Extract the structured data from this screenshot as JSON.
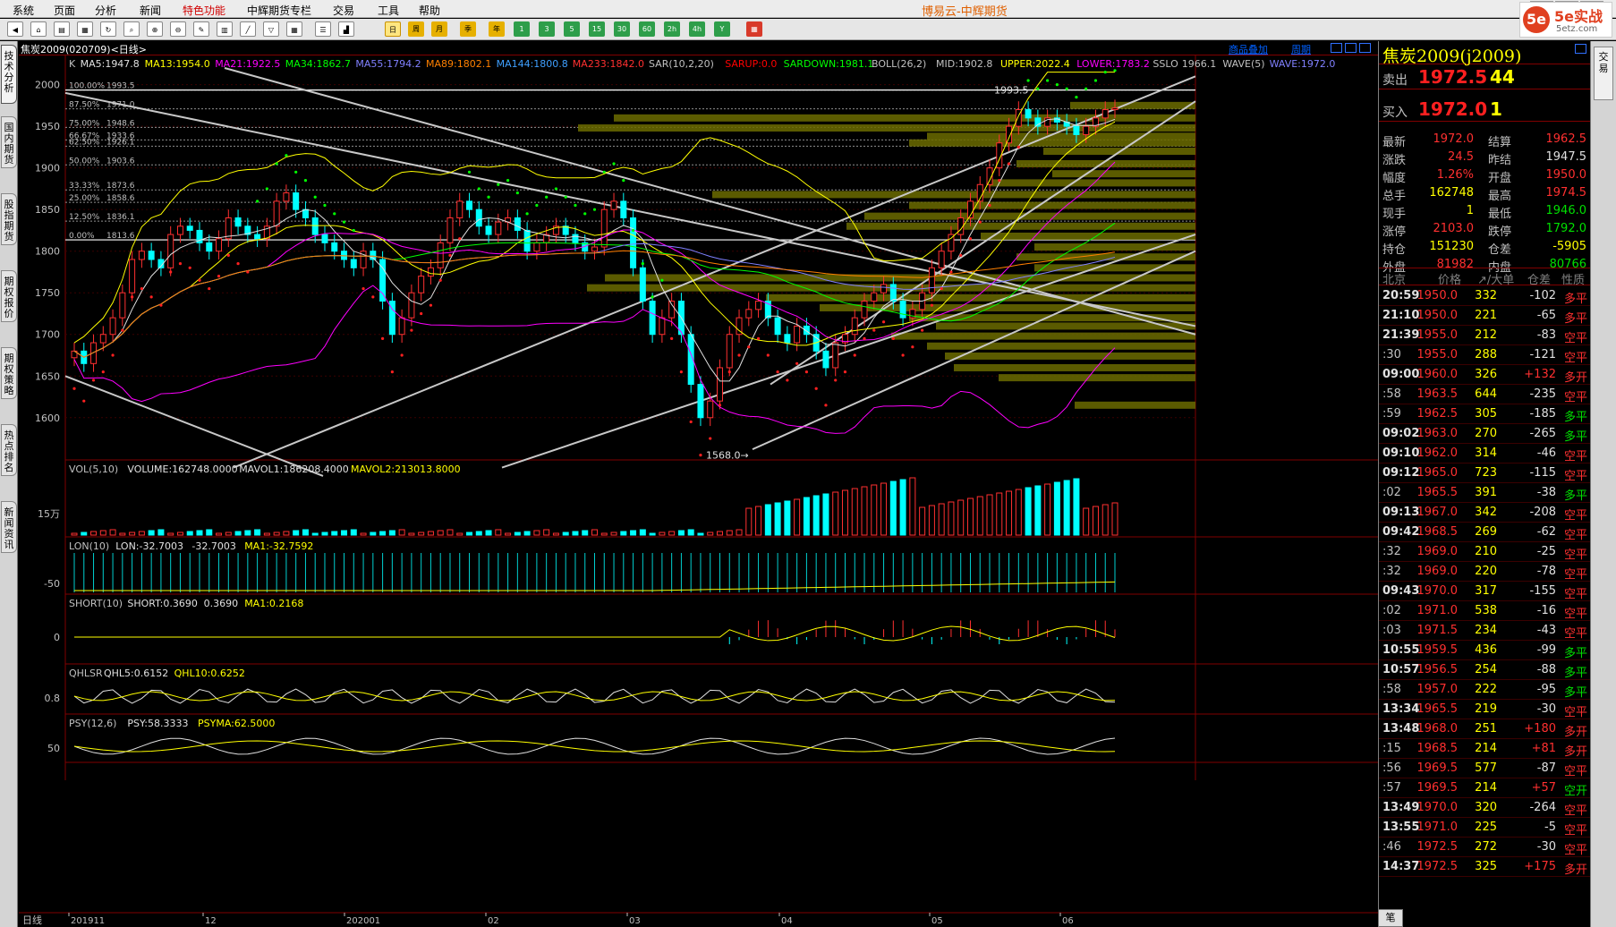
{
  "app_title": "博易云-中辉期货",
  "menu": [
    "系统",
    "页面",
    "分析",
    "新闻",
    "特色功能",
    "中辉期货专栏",
    "交易",
    "工具",
    "帮助"
  ],
  "toolbar": {
    "period_labels": [
      "日",
      "周",
      "月",
      "季",
      "年",
      "1",
      "3",
      "5",
      "15",
      "30",
      "60",
      "2h",
      "4h",
      "Y"
    ],
    "active_period": "日"
  },
  "logo": {
    "mark": "5e",
    "brand": "5e实战",
    "url_text": "5etz.com"
  },
  "left_tabs": [
    "技术分析",
    "国内期货",
    "股指期货",
    "期权报价",
    "期权策略",
    "热点排名",
    "新闻资讯"
  ],
  "right_tab": "交易",
  "chart": {
    "title": "焦炭2009(020709)<日线>",
    "link_overlay": "商品叠加",
    "link_cycle": "周期",
    "main_indicators": [
      {
        "text": "K",
        "color": "#c0c0c0"
      },
      {
        "text": "MA5:1947.8",
        "color": "#e0e0e0"
      },
      {
        "text": "MA13:1954.0",
        "color": "#ffff00"
      },
      {
        "text": "MA21:1922.5",
        "color": "#ff00ff"
      },
      {
        "text": "MA34:1862.7",
        "color": "#00ff00"
      },
      {
        "text": "MA55:1794.2",
        "color": "#8080ff"
      },
      {
        "text": "MA89:1802.1",
        "color": "#ff8000"
      },
      {
        "text": "MA144:1800.8",
        "color": "#3fa0ff"
      },
      {
        "text": "MA233:1842.0",
        "color": "#ff3030"
      },
      {
        "text": "SAR(10,2,20)",
        "color": "#c0c0c0"
      },
      {
        "text": "SARUP:0.0",
        "color": "#ff0000"
      },
      {
        "text": "SARDOWN:1981.1",
        "color": "#00ff00"
      },
      {
        "text": "BOLL(26,2)",
        "color": "#c0c0c0"
      },
      {
        "text": "MID:1902.8",
        "color": "#c0c0c0"
      },
      {
        "text": "UPPER:2022.4",
        "color": "#ffff00"
      },
      {
        "text": "LOWER:1783.2",
        "color": "#ff00ff"
      },
      {
        "text": "SSLO",
        "color": "#c0c0c0"
      },
      {
        "text": "1966.1",
        "color": "#c0c0c0"
      },
      {
        "text": "WAVE(5)",
        "color": "#c0c0c0"
      },
      {
        "text": "WAVE:1972.0",
        "color": "#8080ff"
      }
    ],
    "price_axis": [
      "2000",
      "1950",
      "1900",
      "1850",
      "1800",
      "1750",
      "1700",
      "1650",
      "1600"
    ],
    "fib_labels": [
      {
        "pct": "100.00%",
        "val": "1993.5"
      },
      {
        "pct": "87.50%",
        "val": "1971.0"
      },
      {
        "pct": "75.00%",
        "val": "1948.6"
      },
      {
        "pct": "66.67%",
        "val": "1933.6"
      },
      {
        "pct": "62.50%",
        "val": "1926.1"
      },
      {
        "pct": "50.00%",
        "val": "1903.6"
      },
      {
        "pct": "33.33%",
        "val": "1873.6"
      },
      {
        "pct": "25.00%",
        "val": "1858.6"
      },
      {
        "pct": "12.50%",
        "val": "1836.1"
      },
      {
        "pct": "0.00%",
        "val": "1813.6"
      }
    ],
    "high_marker": "1993.5",
    "low_marker": "1568.0",
    "vol": {
      "indicators": [
        {
          "text": "VOL(5,10)",
          "color": "#c0c0c0"
        },
        {
          "text": "VOLUME:162748.0000",
          "color": "#e0e0e0"
        },
        {
          "text": "MAVOL1:186208.4000",
          "color": "#e0e0e0"
        },
        {
          "text": "MAVOL2:213013.8000",
          "color": "#ffff00"
        }
      ],
      "axis": "15万"
    },
    "lon": {
      "indicators": [
        {
          "text": "LON(10)",
          "color": "#c0c0c0"
        },
        {
          "text": "LON:-32.7003",
          "color": "#e0e0e0"
        },
        {
          "text": "-32.7003",
          "color": "#e0e0e0"
        },
        {
          "text": "MA1:-32.7592",
          "color": "#ffff00"
        }
      ],
      "axis": "-50"
    },
    "short": {
      "indicators": [
        {
          "text": "SHORT(10)",
          "color": "#c0c0c0"
        },
        {
          "text": "SHORT:0.3690",
          "color": "#e0e0e0"
        },
        {
          "text": "0.3690",
          "color": "#e0e0e0"
        },
        {
          "text": "MA1:0.2168",
          "color": "#ffff00"
        }
      ],
      "axis": "0"
    },
    "qhl": {
      "indicators": [
        {
          "text": "QHLSR",
          "color": "#c0c0c0"
        },
        {
          "text": "QHL5:0.6152",
          "color": "#e0e0e0"
        },
        {
          "text": "QHL10:0.6252",
          "color": "#ffff00"
        }
      ],
      "axis": "0.8"
    },
    "psy": {
      "indicators": [
        {
          "text": "PSY(12,6)",
          "color": "#c0c0c0"
        },
        {
          "text": "PSY:58.3333",
          "color": "#e0e0e0"
        },
        {
          "text": "PSYMA:62.5000",
          "color": "#ffff00"
        }
      ],
      "axis": "50"
    },
    "period_label": "日线",
    "date_labels": [
      "201911",
      "12",
      "202001",
      "02",
      "03",
      "04",
      "05",
      "06"
    ]
  },
  "quote": {
    "name": "焦炭2009(j2009)",
    "sell": {
      "label": "卖出",
      "price": "1972.5",
      "vol": "44"
    },
    "buy": {
      "label": "买入",
      "price": "1972.0",
      "vol": "1"
    },
    "rows": [
      {
        "l1": "最新",
        "v1": "1972.0",
        "c1": "red",
        "l2": "结算",
        "v2": "1962.5",
        "c2": "red"
      },
      {
        "l1": "涨跌",
        "v1": "24.5",
        "c1": "red",
        "l2": "昨结",
        "v2": "1947.5",
        "c2": "wht"
      },
      {
        "l1": "幅度",
        "v1": "1.26%",
        "c1": "red",
        "l2": "开盘",
        "v2": "1950.0",
        "c2": "red"
      },
      {
        "l1": "总手",
        "v1": "162748",
        "c1": "yel",
        "l2": "最高",
        "v2": "1974.5",
        "c2": "red"
      },
      {
        "l1": "现手",
        "v1": "1",
        "c1": "yel",
        "l2": "最低",
        "v2": "1946.0",
        "c2": "grn"
      },
      {
        "l1": "涨停",
        "v1": "2103.0",
        "c1": "red",
        "l2": "跌停",
        "v2": "1792.0",
        "c2": "grn"
      },
      {
        "l1": "持仓",
        "v1": "151230",
        "c1": "yel",
        "l2": "仓差",
        "v2": "-5905",
        "c2": "yel"
      },
      {
        "l1": "外盘",
        "v1": "81982",
        "c1": "red",
        "l2": "内盘",
        "v2": "80766",
        "c2": "grn"
      }
    ],
    "ticks_header": [
      "北京",
      "价格",
      "↗/大单",
      "仓差",
      "性质"
    ],
    "ticks": [
      {
        "t": "20:59",
        "p": "1950.0",
        "v": "332",
        "o": "-102",
        "n": "多平",
        "nc": "red"
      },
      {
        "t": "21:10",
        "p": "1950.0",
        "v": "221",
        "o": "-65",
        "n": "多平",
        "nc": "red"
      },
      {
        "t": "21:39",
        "p": "1955.0",
        "v": "212",
        "o": "-83",
        "n": "空平",
        "nc": "red"
      },
      {
        "t": ":30",
        "p": "1955.0",
        "v": "288",
        "o": "-121",
        "n": "空平",
        "nc": "red"
      },
      {
        "t": "09:00",
        "p": "1960.0",
        "v": "326",
        "o": "+132",
        "n": "多开",
        "nc": "red"
      },
      {
        "t": ":58",
        "p": "1963.5",
        "v": "644",
        "o": "-235",
        "n": "空平",
        "nc": "red"
      },
      {
        "t": ":59",
        "p": "1962.5",
        "v": "305",
        "o": "-185",
        "n": "多平",
        "nc": "grn"
      },
      {
        "t": "09:02",
        "p": "1963.0",
        "v": "270",
        "o": "-265",
        "n": "多平",
        "nc": "grn"
      },
      {
        "t": "09:10",
        "p": "1962.0",
        "v": "314",
        "o": "-46",
        "n": "空平",
        "nc": "red"
      },
      {
        "t": "09:12",
        "p": "1965.0",
        "v": "723",
        "o": "-115",
        "n": "空平",
        "nc": "red"
      },
      {
        "t": ":02",
        "p": "1965.5",
        "v": "391",
        "o": "-38",
        "n": "多平",
        "nc": "grn"
      },
      {
        "t": "09:13",
        "p": "1967.0",
        "v": "342",
        "o": "-208",
        "n": "空平",
        "nc": "red"
      },
      {
        "t": "09:42",
        "p": "1968.5",
        "v": "269",
        "o": "-62",
        "n": "空平",
        "nc": "red"
      },
      {
        "t": ":32",
        "p": "1969.0",
        "v": "210",
        "o": "-25",
        "n": "空平",
        "nc": "red"
      },
      {
        "t": ":32",
        "p": "1969.0",
        "v": "220",
        "o": "-78",
        "n": "空平",
        "nc": "red"
      },
      {
        "t": "09:43",
        "p": "1970.0",
        "v": "317",
        "o": "-155",
        "n": "空平",
        "nc": "red"
      },
      {
        "t": ":02",
        "p": "1971.0",
        "v": "538",
        "o": "-16",
        "n": "空平",
        "nc": "red"
      },
      {
        "t": ":03",
        "p": "1971.5",
        "v": "234",
        "o": "-43",
        "n": "空平",
        "nc": "red"
      },
      {
        "t": "10:55",
        "p": "1959.5",
        "v": "436",
        "o": "-99",
        "n": "多平",
        "nc": "grn"
      },
      {
        "t": "10:57",
        "p": "1956.5",
        "v": "254",
        "o": "-88",
        "n": "多平",
        "nc": "grn"
      },
      {
        "t": ":58",
        "p": "1957.0",
        "v": "222",
        "o": "-95",
        "n": "多平",
        "nc": "grn"
      },
      {
        "t": "13:34",
        "p": "1965.5",
        "v": "219",
        "o": "-30",
        "n": "空平",
        "nc": "red"
      },
      {
        "t": "13:48",
        "p": "1968.0",
        "v": "251",
        "o": "+180",
        "n": "多开",
        "nc": "red"
      },
      {
        "t": ":15",
        "p": "1968.5",
        "v": "214",
        "o": "+81",
        "n": "多开",
        "nc": "red"
      },
      {
        "t": ":56",
        "p": "1969.5",
        "v": "577",
        "o": "-87",
        "n": "空平",
        "nc": "red"
      },
      {
        "t": ":57",
        "p": "1969.5",
        "v": "214",
        "o": "+57",
        "n": "空开",
        "nc": "grn"
      },
      {
        "t": "13:49",
        "p": "1970.0",
        "v": "320",
        "o": "-264",
        "n": "空平",
        "nc": "red"
      },
      {
        "t": "13:55",
        "p": "1971.0",
        "v": "225",
        "o": "-5",
        "n": "空平",
        "nc": "red"
      },
      {
        "t": ":46",
        "p": "1972.5",
        "v": "272",
        "o": "-30",
        "n": "空平",
        "nc": "red"
      },
      {
        "t": "14:37",
        "p": "1972.5",
        "v": "325",
        "o": "+175",
        "n": "多开",
        "nc": "red"
      }
    ],
    "bottom_btn": "笔"
  },
  "chart_data": {
    "type": "candlestick",
    "x_start": "201911",
    "x_end": "202006",
    "ylim": [
      1560,
      2020
    ],
    "values_close": [
      1680,
      1665,
      1690,
      1700,
      1720,
      1750,
      1790,
      1800,
      1790,
      1780,
      1820,
      1830,
      1825,
      1810,
      1800,
      1815,
      1840,
      1830,
      1820,
      1815,
      1830,
      1860,
      1870,
      1850,
      1840,
      1820,
      1810,
      1800,
      1790,
      1780,
      1800,
      1790,
      1740,
      1700,
      1720,
      1750,
      1770,
      1780,
      1810,
      1840,
      1860,
      1850,
      1830,
      1820,
      1835,
      1840,
      1825,
      1800,
      1810,
      1820,
      1830,
      1820,
      1810,
      1800,
      1805,
      1850,
      1860,
      1840,
      1780,
      1740,
      1700,
      1720,
      1740,
      1700,
      1640,
      1600,
      1620,
      1660,
      1700,
      1720,
      1730,
      1740,
      1720,
      1700,
      1690,
      1710,
      1700,
      1680,
      1660,
      1690,
      1700,
      1720,
      1740,
      1750,
      1760,
      1740,
      1720,
      1730,
      1750,
      1780,
      1800,
      1820,
      1840,
      1860,
      1880,
      1900,
      1930,
      1950,
      1970,
      1960,
      1950,
      1960,
      1955,
      1950,
      1940,
      1950,
      1960,
      1970,
      1972
    ]
  }
}
